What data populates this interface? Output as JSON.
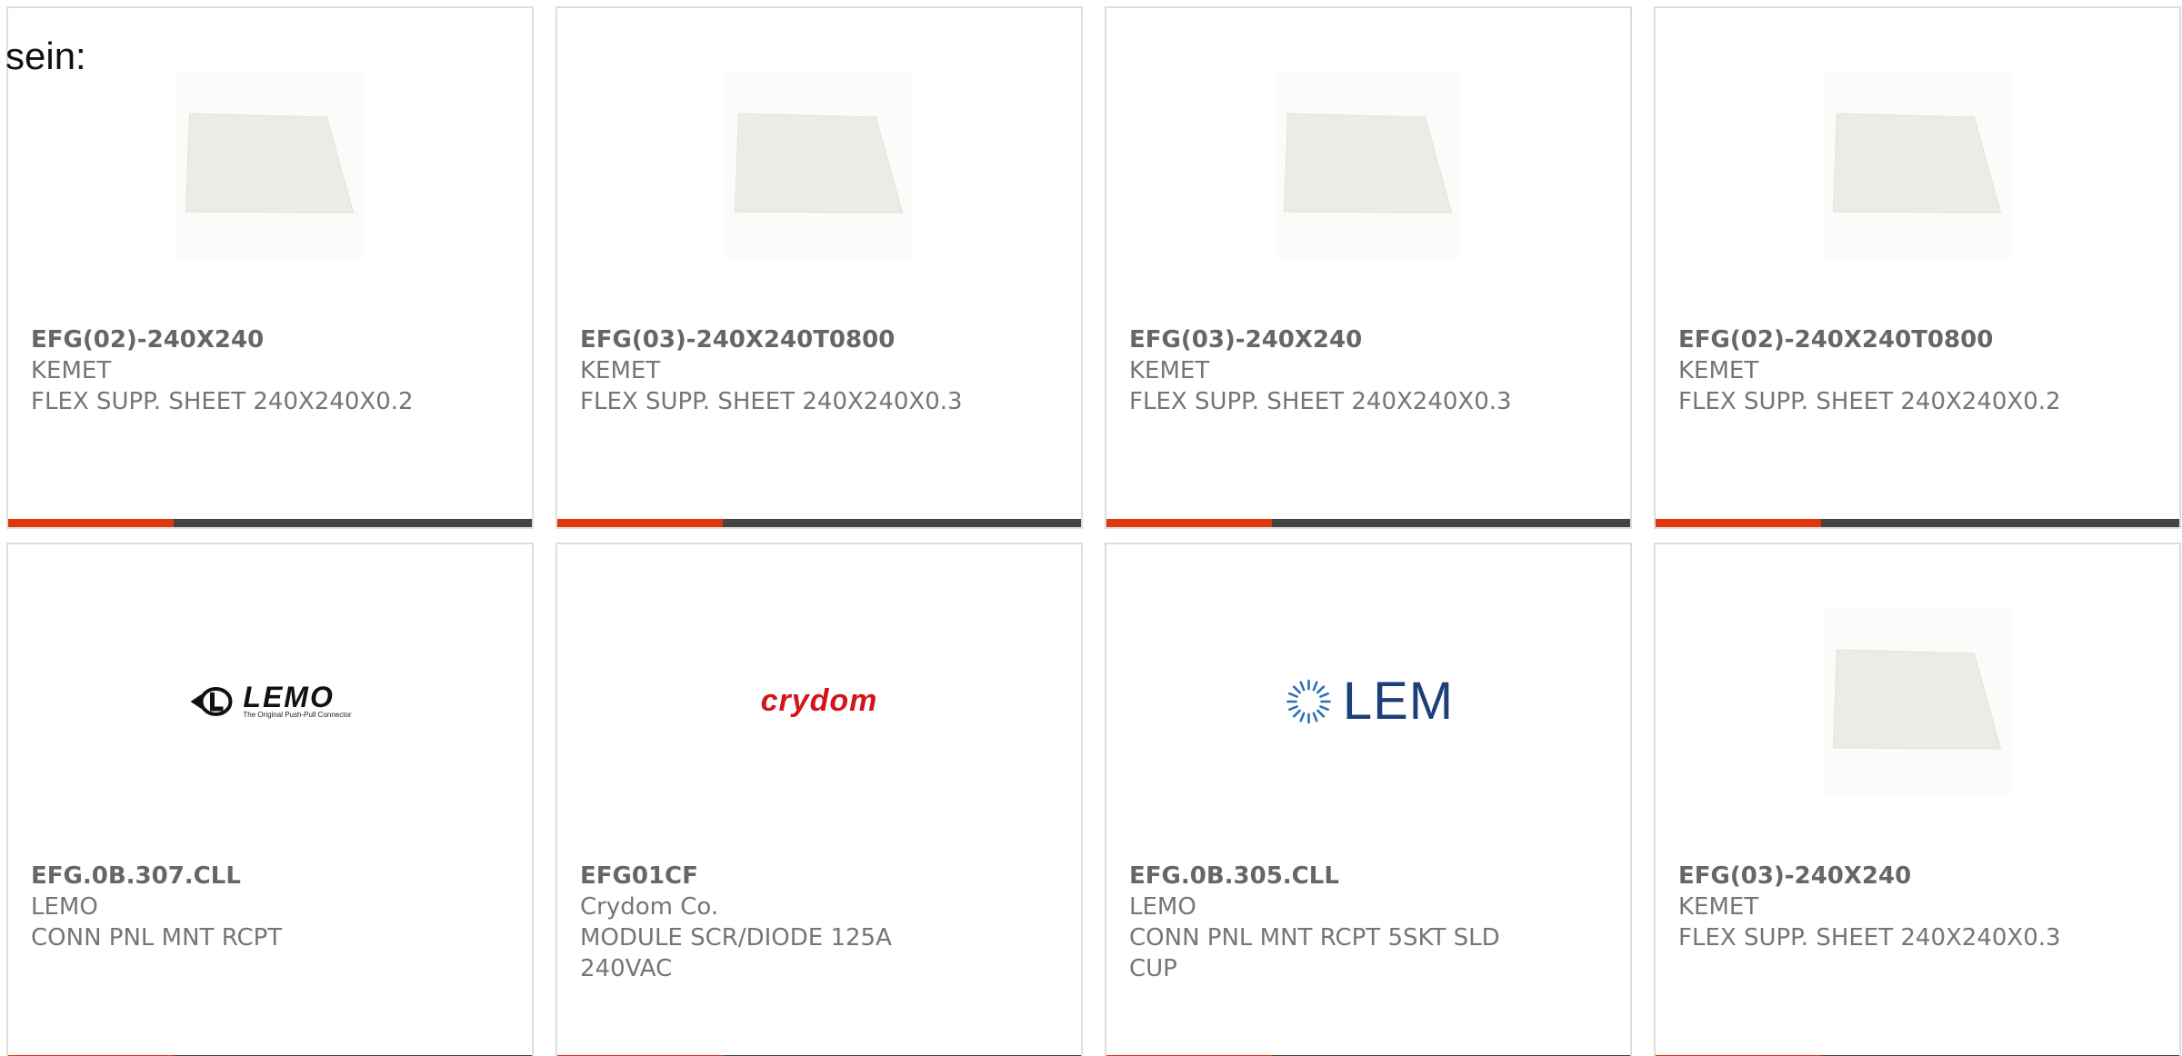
{
  "intro_text": "sein:",
  "colors": {
    "accent": "#e0360c",
    "bar": "#444444",
    "card_border": "#dddddd",
    "text": "#757575",
    "crydom_red": "#d3151b",
    "lem_blue": "#1c3f7a"
  },
  "products": [
    {
      "part_number": "EFG(02)-240X240",
      "manufacturer": "KEMET",
      "description": "FLEX SUPP. SHEET 240X240X0.2",
      "image": "sheet-photo"
    },
    {
      "part_number": "EFG(03)-240X240T0800",
      "manufacturer": "KEMET",
      "description": "FLEX SUPP. SHEET 240X240X0.3",
      "image": "sheet-photo"
    },
    {
      "part_number": "EFG(03)-240X240",
      "manufacturer": "KEMET",
      "description": "FLEX SUPP. SHEET 240X240X0.3",
      "image": "sheet-photo"
    },
    {
      "part_number": "EFG(02)-240X240T0800",
      "manufacturer": "KEMET",
      "description": "FLEX SUPP. SHEET 240X240X0.2",
      "image": "sheet-photo"
    },
    {
      "part_number": "EFG.0B.307.CLL",
      "manufacturer": "LEMO",
      "description": "CONN PNL MNT RCPT",
      "image": "lemo-logo",
      "logo_text": "LEMO",
      "logo_tagline": "The Original Push-Pull Connector"
    },
    {
      "part_number": "EFG01CF",
      "manufacturer": "Crydom Co.",
      "description": "MODULE SCR/DIODE 125A 240VAC",
      "image": "crydom-logo",
      "logo_text": "crydom"
    },
    {
      "part_number": "EFG.0B.305.CLL",
      "manufacturer": "LEMO",
      "description": "CONN PNL MNT RCPT 5SKT SLD CUP",
      "image": "lem-logo",
      "logo_text": "LEM"
    },
    {
      "part_number": "EFG(03)-240X240",
      "manufacturer": "KEMET",
      "description": "FLEX SUPP. SHEET 240X240X0.3",
      "image": "sheet-photo"
    }
  ]
}
